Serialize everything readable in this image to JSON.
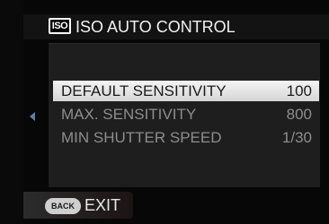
{
  "header": {
    "icon_text": "ISO",
    "title": "ISO AUTO CONTROL"
  },
  "menu": {
    "items": [
      {
        "label": "DEFAULT SENSITIVITY",
        "value": "100",
        "selected": true
      },
      {
        "label": "MAX. SENSITIVITY",
        "value": "800",
        "selected": false
      },
      {
        "label": "MIN SHUTTER SPEED",
        "value": "1/30",
        "selected": false
      }
    ]
  },
  "footer": {
    "back_icon_text": "BACK",
    "exit_label": "EXIT"
  },
  "colors": {
    "highlight": "#f0f0f0",
    "inactive_text": "#8d8d8d",
    "arrow": "#5c7fa8"
  },
  "icons": [
    "iso-icon",
    "left-arrow-icon",
    "back-button-icon"
  ]
}
